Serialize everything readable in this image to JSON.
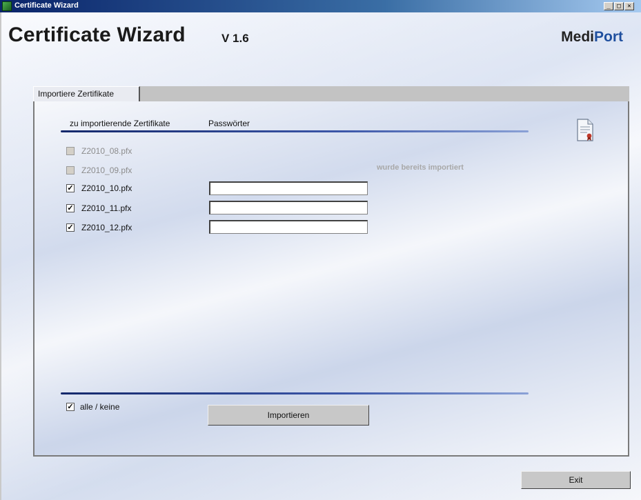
{
  "window": {
    "title": "Certificate Wizard",
    "controls": {
      "minimize": "_",
      "maximize": "□",
      "close": "✕"
    }
  },
  "header": {
    "title": "Certificate Wizard",
    "version": "V 1.6",
    "brand_part1": "Medi",
    "brand_part2": "Port",
    "brand_color": "#1f4f9e"
  },
  "tab": {
    "label": "Importiere  Zertifikate"
  },
  "columns": {
    "certificates": "zu importierende Zertifikate",
    "passwords": "Passwörter"
  },
  "certificates": [
    {
      "name": "Z2010_08.pfx",
      "checked": false,
      "enabled": false
    },
    {
      "name": "Z2010_09.pfx",
      "checked": false,
      "enabled": false
    },
    {
      "name": "Z2010_10.pfx",
      "checked": true,
      "enabled": true,
      "password": ""
    },
    {
      "name": "Z2010_11.pfx",
      "checked": true,
      "enabled": true,
      "password": ""
    },
    {
      "name": "Z2010_12.pfx",
      "checked": true,
      "enabled": true,
      "password": ""
    }
  ],
  "status": {
    "already_imported": "wurde bereits importiert"
  },
  "footer": {
    "select_all_label": "alle / keine",
    "select_all_checked": true,
    "import_button": "Importieren",
    "exit_button": "Exit"
  },
  "icons": {
    "certificate": "certificate-document-icon",
    "app": "app-icon"
  }
}
